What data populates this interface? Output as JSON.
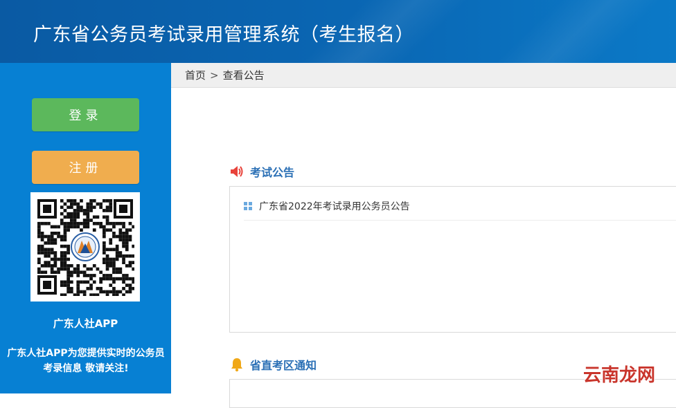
{
  "header": {
    "title": "广东省公务员考试录用管理系统（考生报名）"
  },
  "sidebar": {
    "login_label": "登录",
    "register_label": "注册",
    "app_name": "广东人社APP",
    "app_desc": "广东人社APP为您提供实时的公务员考录信息 敬请关注!"
  },
  "breadcrumb": {
    "home": "首页",
    "separator": ">",
    "current": "查看公告"
  },
  "sections": [
    {
      "title": "考试公告",
      "icon": "speaker-icon",
      "items": [
        {
          "label": "广东省2022年考试录用公务员公告"
        }
      ]
    },
    {
      "title": "省直考区通知",
      "icon": "bell-icon",
      "items": []
    }
  ],
  "watermark": "云南龙网",
  "colors": {
    "header": "#0a67b4",
    "sidebar": "#0780d3",
    "login_button": "#5cb85c",
    "register_button": "#f0ad4e",
    "section_title": "#2a6fb5"
  }
}
